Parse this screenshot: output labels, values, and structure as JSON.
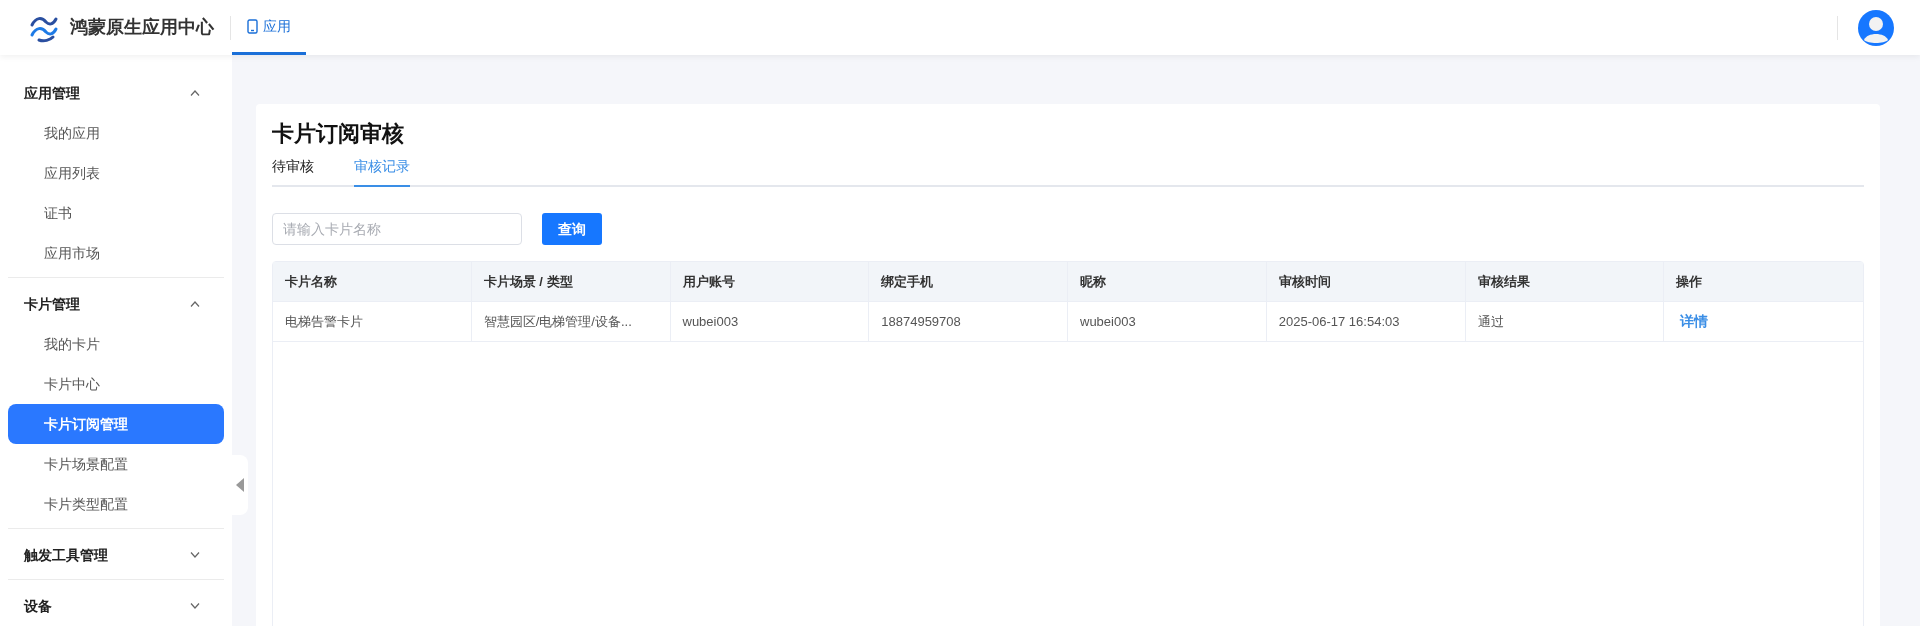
{
  "header": {
    "app_name": "鸿蒙原生应用中心",
    "nav": [
      {
        "label": "应用",
        "selected": true
      }
    ]
  },
  "sidebar": {
    "groups": [
      {
        "label": "应用管理",
        "expanded": true,
        "items": [
          {
            "label": "我的应用",
            "selected": false
          },
          {
            "label": "应用列表",
            "selected": false
          },
          {
            "label": "证书",
            "selected": false
          },
          {
            "label": "应用市场",
            "selected": false
          }
        ]
      },
      {
        "label": "卡片管理",
        "expanded": true,
        "items": [
          {
            "label": "我的卡片",
            "selected": false
          },
          {
            "label": "卡片中心",
            "selected": false
          },
          {
            "label": "卡片订阅管理",
            "selected": true
          },
          {
            "label": "卡片场景配置",
            "selected": false
          },
          {
            "label": "卡片类型配置",
            "selected": false
          }
        ]
      },
      {
        "label": "触发工具管理",
        "expanded": false
      },
      {
        "label": "设备",
        "expanded": false
      }
    ]
  },
  "page": {
    "title": "卡片订阅审核",
    "tabs": [
      {
        "label": "待审核",
        "selected": false
      },
      {
        "label": "审核记录",
        "selected": true
      }
    ],
    "search": {
      "placeholder": "请输入卡片名称",
      "button": "查询"
    },
    "table": {
      "columns": [
        "卡片名称",
        "卡片场景 / 类型",
        "用户账号",
        "绑定手机",
        "昵称",
        "审核时间",
        "审核结果",
        "操作"
      ],
      "rows": [
        {
          "cells": [
            "电梯告警卡片",
            "智慧园区/电梯管理/设备...",
            "wubei003",
            "18874959708",
            "wubei003",
            "2025-06-17 16:54:03",
            "通过"
          ],
          "action": "详情"
        }
      ]
    }
  }
}
